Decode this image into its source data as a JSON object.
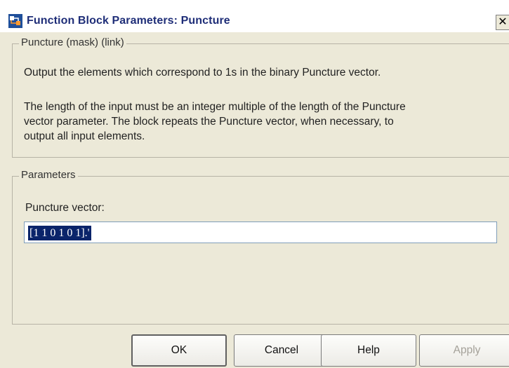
{
  "window": {
    "title": "Function Block Parameters: Puncture",
    "close_glyph": "✕"
  },
  "mask_group": {
    "title": "Puncture (mask) (link)",
    "description_1": "Output the elements which correspond to 1s in the binary Puncture vector.",
    "description_2_lines": [
      "The length of the input must be an integer multiple of the length of the Puncture",
      "vector parameter. The block repeats the Puncture vector, when necessary, to",
      "output all input elements."
    ]
  },
  "parameters_group": {
    "title": "Parameters",
    "puncture_vector_label": "Puncture vector:",
    "puncture_vector_value": "[1 1 0 1 0 1].'"
  },
  "buttons": {
    "ok": "OK",
    "cancel": "Cancel",
    "help": "Help",
    "apply": "Apply"
  },
  "icons": {
    "title_icon": "simulink-block-icon",
    "close": "close-icon"
  }
}
